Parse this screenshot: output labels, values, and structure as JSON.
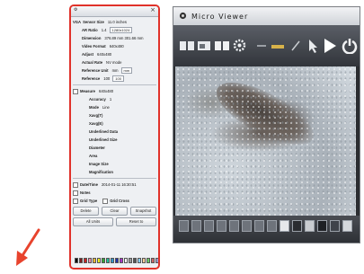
{
  "settings_panel": {
    "rows": [
      {
        "label": "VGA",
        "text": "Sensor Size",
        "value": "11.0 inches"
      },
      {
        "label": "",
        "text": "AR Ratio",
        "value": "1.4",
        "box": "1280x1024"
      },
      {
        "label": "",
        "text": "Dimension",
        "value": "376.89 mm 301.66 mm"
      },
      {
        "label": "",
        "text": "Video Format",
        "value": "640x480"
      },
      {
        "label": "",
        "text": "Adjust",
        "value": "640x480"
      },
      {
        "label": "",
        "text": "Actual Rate",
        "value": "NV mode"
      },
      {
        "label": "",
        "text": "Reference Unit",
        "value": "mm",
        "box": "mm"
      },
      {
        "label": "",
        "text": "Reference",
        "value": "100",
        "box": "100"
      }
    ],
    "measure_rows": [
      {
        "text": "Measure",
        "value": "640x480"
      },
      {
        "text": "Accuracy",
        "value": "1"
      },
      {
        "text": "Mode",
        "value": "Line"
      },
      {
        "text": "Xavg(T)",
        "value": ""
      },
      {
        "text": "Xavg(E)",
        "value": ""
      },
      {
        "text": "Underlined Data",
        "value": ""
      },
      {
        "text": "Underlined Size",
        "value": ""
      },
      {
        "text": "Diameter",
        "value": ""
      },
      {
        "text": "Area",
        "value": ""
      },
      {
        "text": "Image Size",
        "value": ""
      },
      {
        "text": "Magnification",
        "value": ""
      }
    ],
    "datetime_label": "Date/Time",
    "datetime_value": "2014-01-11  16:30:51",
    "notes_label": "Notes",
    "grid_type_label": "Grid Type",
    "grid_cross_label": "Grid Cross",
    "buttons": [
      "Delete",
      "Clear",
      "Snapshot"
    ],
    "buttons2": [
      "All Units",
      "Reset to"
    ],
    "palette": [
      "#000000",
      "#7a1f1f",
      "#c22",
      "#e8a",
      "#fb3",
      "#ee2",
      "#3a3",
      "#2b9",
      "#39c",
      "#23a",
      "#a3c",
      "#fff",
      "#999",
      "#555",
      "#8cf",
      "#fc9",
      "#6c6",
      "#c66",
      "#99c"
    ]
  },
  "viewer": {
    "title": "Micro Viewer"
  },
  "arrow": {
    "color": "#e8432d"
  }
}
